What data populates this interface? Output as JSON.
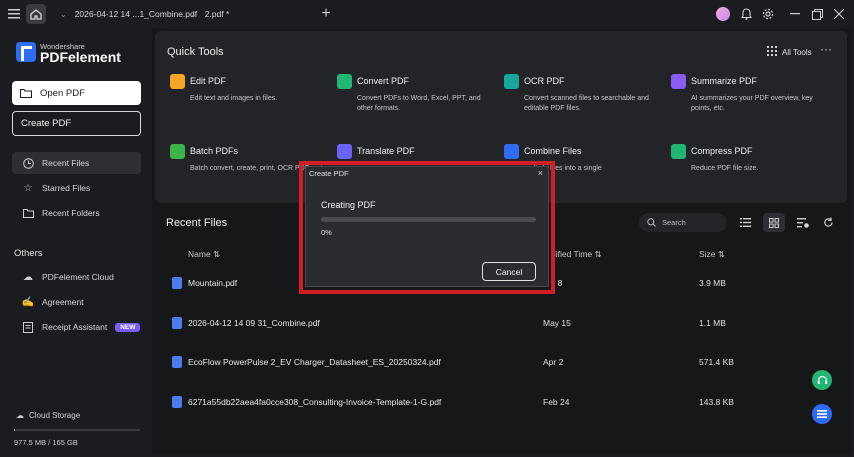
{
  "titlebar": {
    "tab1": "2026-04-12 14 ...1_Combine.pdf",
    "tab2": "2.pdf *",
    "new_tab": "+"
  },
  "sidebar": {
    "brand_small": "Wondershare",
    "brand_big": "PDFelement",
    "open_pdf": "Open PDF",
    "create_pdf": "Create PDF",
    "items": [
      {
        "label": "Recent Files",
        "icon": "clock-icon"
      },
      {
        "label": "Starred Files",
        "icon": "star-icon"
      },
      {
        "label": "Recent Folders",
        "icon": "folder-icon"
      }
    ],
    "others_label": "Others",
    "others": [
      {
        "label": "PDFelement Cloud",
        "icon": "cloud-icon"
      },
      {
        "label": "Agreement",
        "icon": "agreement-icon"
      },
      {
        "label": "Receipt Assistant",
        "icon": "receipt-icon",
        "badge": "NEW"
      }
    ],
    "cloud_storage": "Cloud Storage",
    "storage_used_fraction": 0.006,
    "storage_text": "977.5 MB / 165 GB"
  },
  "quick_tools": {
    "title": "Quick Tools",
    "all_tools": "All Tools",
    "more": "···",
    "tools": [
      {
        "name": "Edit PDF",
        "desc": "Edit text and images in files.",
        "color": "#f5a524"
      },
      {
        "name": "Convert PDF",
        "desc": "Convert PDFs to Word, Excel, PPT, and other formats.",
        "color": "#22b573"
      },
      {
        "name": "OCR PDF",
        "desc": "Convert scanned files to searchable and editable PDF files.",
        "color": "#16a79a"
      },
      {
        "name": "Summarize PDF",
        "desc": "AI summarizes your PDF overview, key points, etc.",
        "color": "#8a5cf6"
      },
      {
        "name": "Batch PDFs",
        "desc": "Batch convert, create, print, OCR PDFs, etc.",
        "color": "#3bb54a"
      },
      {
        "name": "Translate PDF",
        "desc": "",
        "color": "#6b63f5"
      },
      {
        "name": "Combine Files",
        "desc": "multiple files into a single",
        "color": "#2f6cf6"
      },
      {
        "name": "Compress PDF",
        "desc": "Reduce PDF file size.",
        "color": "#21b573"
      }
    ]
  },
  "recent": {
    "title": "Recent Files",
    "search_placeholder": "Search",
    "col_name": "Name ⇅",
    "col_time": "dified Time ⇅",
    "col_size": "Size ⇅",
    "files": [
      {
        "name": "Mountain.pdf",
        "time": "y 8",
        "size": "3.9 MB"
      },
      {
        "name": "2026-04-12 14 09 31_Combine.pdf",
        "time": "May 15",
        "size": "1.1 MB"
      },
      {
        "name": "EcoFlow PowerPulse 2_EV Charger_Datasheet_ES_20250324.pdf",
        "time": "Apr 2",
        "size": "571.4 KB"
      },
      {
        "name": "6271a55db22aea4fa0cce308_Consulting-Invoice-Template-1-G.pdf",
        "time": "Feb 24",
        "size": "143.8 KB"
      }
    ]
  },
  "dialog": {
    "title": "Create PDF",
    "close": "×",
    "heading": "Creating PDF",
    "progress_fraction": 0,
    "percent": "0%",
    "cancel": "Cancel"
  },
  "colors": {
    "accent": "#2f6cf6",
    "highlight_frame": "#d21f26",
    "progress_track": "#4a4b50"
  }
}
